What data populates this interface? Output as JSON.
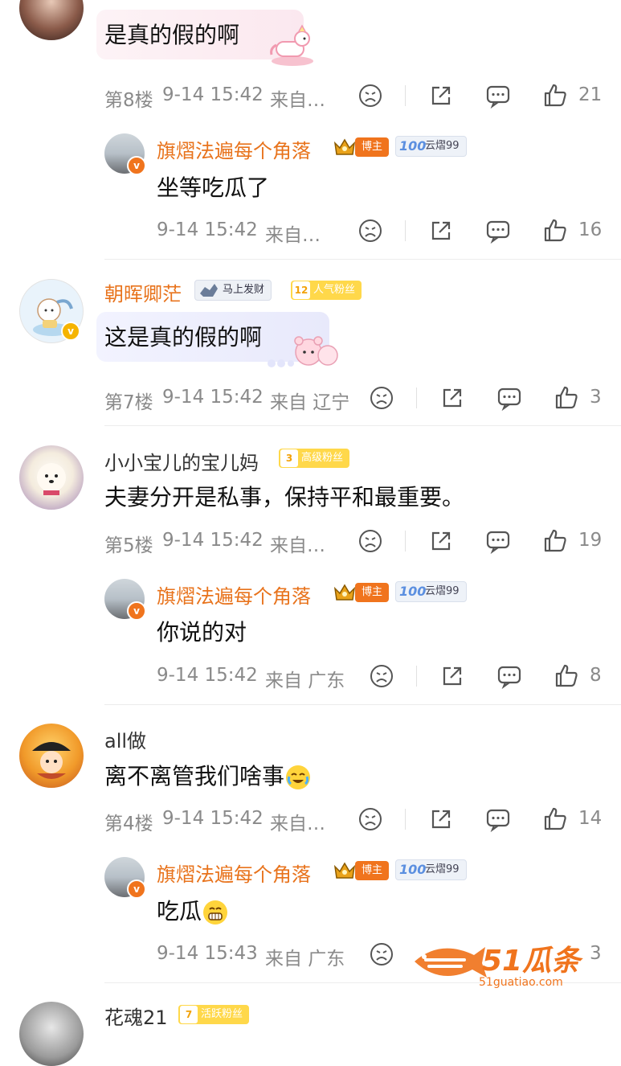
{
  "comments": [
    {
      "text": "是真的假的啊",
      "floor": "第8楼",
      "time": "9-14 15:42",
      "source": "来自…",
      "shares": "",
      "comments": "",
      "likes": "21",
      "reply": {
        "name": "旗熠法遍每个角落",
        "tag_role": "博主",
        "tag_extra": "云熠99",
        "text": "坐等吃瓜了",
        "time": "9-14 15:42",
        "source": "来自…",
        "likes": "16"
      }
    },
    {
      "name": "朝晖卿茫",
      "tag_mascot": "马上发财",
      "fan_level": "12",
      "fan_label": "人气粉丝",
      "text": "这是真的假的啊",
      "floor": "第7楼",
      "time": "9-14 15:42",
      "source": "来自 辽宁",
      "likes": "3"
    },
    {
      "name": "小小宝儿的宝儿妈",
      "fan_level": "3",
      "fan_label": "高级粉丝",
      "text": "夫妻分开是私事，保持平和最重要。",
      "floor": "第5楼",
      "time": "9-14 15:42",
      "source": "来自…",
      "likes": "19",
      "reply": {
        "name": "旗熠法遍每个角落",
        "tag_role": "博主",
        "tag_extra": "云熠99",
        "text": "你说的对",
        "time": "9-14 15:42",
        "source": "来自 广东",
        "likes": "8"
      }
    },
    {
      "name": "all做",
      "text": "离不离管我们啥事",
      "floor": "第4楼",
      "time": "9-14 15:42",
      "source": "来自…",
      "likes": "14",
      "reply": {
        "name": "旗熠法遍每个角落",
        "tag_role": "博主",
        "tag_extra": "云熠99",
        "text": "吃瓜",
        "time": "9-14 15:43",
        "source": "来自 广东",
        "likes": "3"
      }
    },
    {
      "name": "花魂21",
      "fan_level": "7",
      "fan_label": "活跃粉丝"
    }
  ],
  "watermark": {
    "brand": "51瓜条",
    "url": "51guatiao.com"
  },
  "colors": {
    "accent_orange": "#e8731c",
    "fan_yellow": "#ffd84a",
    "meta_gray": "#8a8a8a"
  }
}
